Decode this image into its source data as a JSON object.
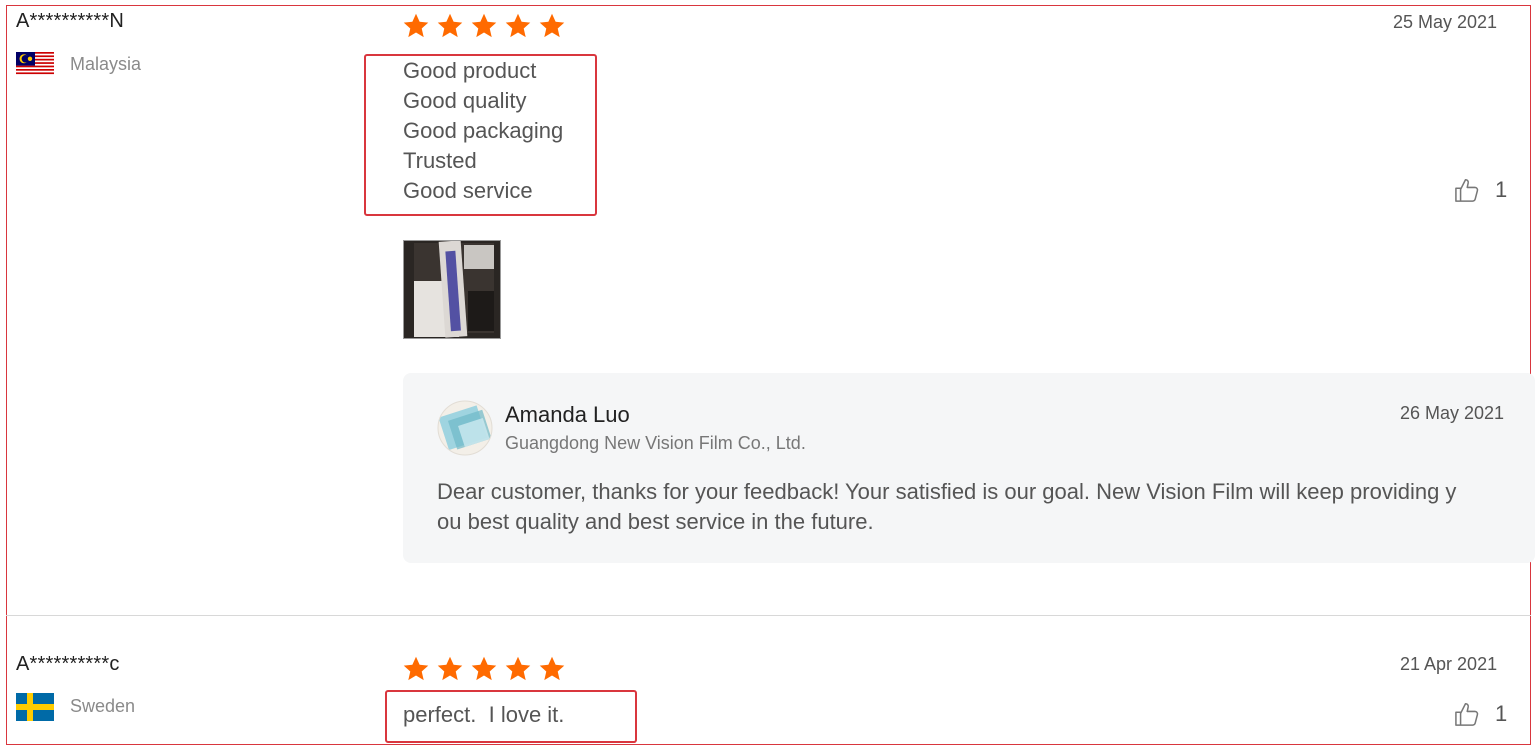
{
  "reviews": [
    {
      "reviewer": "A**********N",
      "country": "Malaysia",
      "rating": 5,
      "date": "25 May 2021",
      "lines": [
        "Good product",
        "Good quality",
        "Good packaging",
        "Trusted",
        "Good service"
      ],
      "likes": "1",
      "reply": {
        "name": "Amanda Luo",
        "company": "Guangdong New Vision Film Co., Ltd.",
        "date": "26 May 2021",
        "text_line1": "Dear customer, thanks for your feedback! Your satisfied is our goal. New Vision Film will keep providing y",
        "text_line2": "ou best quality and best service in the future."
      }
    },
    {
      "reviewer": "A**********c",
      "country": "Sweden",
      "rating": 5,
      "date": "21 Apr 2021",
      "text": "perfect.  I love it.",
      "likes": "1"
    }
  ],
  "colors": {
    "star": "#ff6a00",
    "highlight": "#d9363e"
  }
}
